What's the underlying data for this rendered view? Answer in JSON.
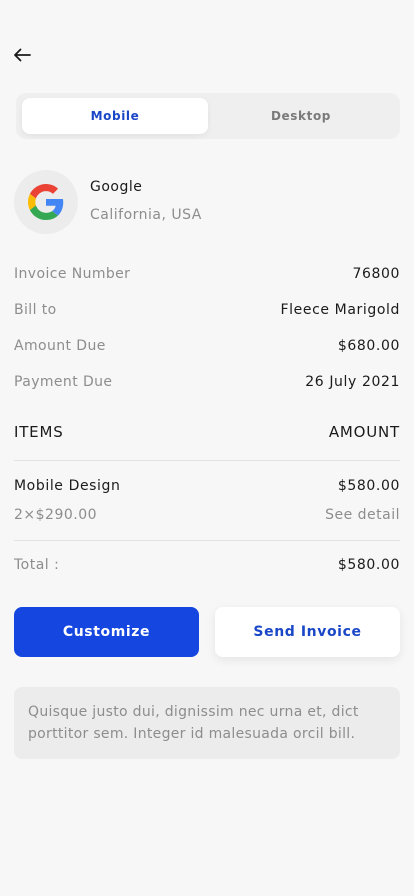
{
  "header": {
    "back_icon": "arrow-left-icon"
  },
  "tabs": [
    {
      "label": "Mobile",
      "active": true
    },
    {
      "label": "Desktop",
      "active": false
    }
  ],
  "company": {
    "logo_icon": "google-logo-icon",
    "name": "Google",
    "location": "California, USA"
  },
  "invoice": {
    "number_label": "Invoice Number",
    "number_value": "76800",
    "bill_to_label": "Bill to",
    "bill_to_value": "Fleece Marigold",
    "amount_due_label": "Amount Due",
    "amount_due_value": "$680.00",
    "payment_due_label": "Payment Due",
    "payment_due_value": "26 July 2021"
  },
  "items_header": {
    "items": "ITEMS",
    "amount": "AMOUNT"
  },
  "items": [
    {
      "name": "Mobile Design",
      "amount": "$580.00",
      "quantity": "2×$290.00",
      "detail_link": "See detail"
    }
  ],
  "total": {
    "label": "Total :",
    "value": "$580.00"
  },
  "actions": {
    "customize": "Customize",
    "send": "Send Invoice"
  },
  "note": "Quisque justo dui, dignissim nec urna et, dict porttitor sem. Integer id malesuada orcil bill.",
  "colors": {
    "accent": "#1547e0",
    "tab_active_text": "#1a47c8",
    "background": "#f7f7f7"
  }
}
